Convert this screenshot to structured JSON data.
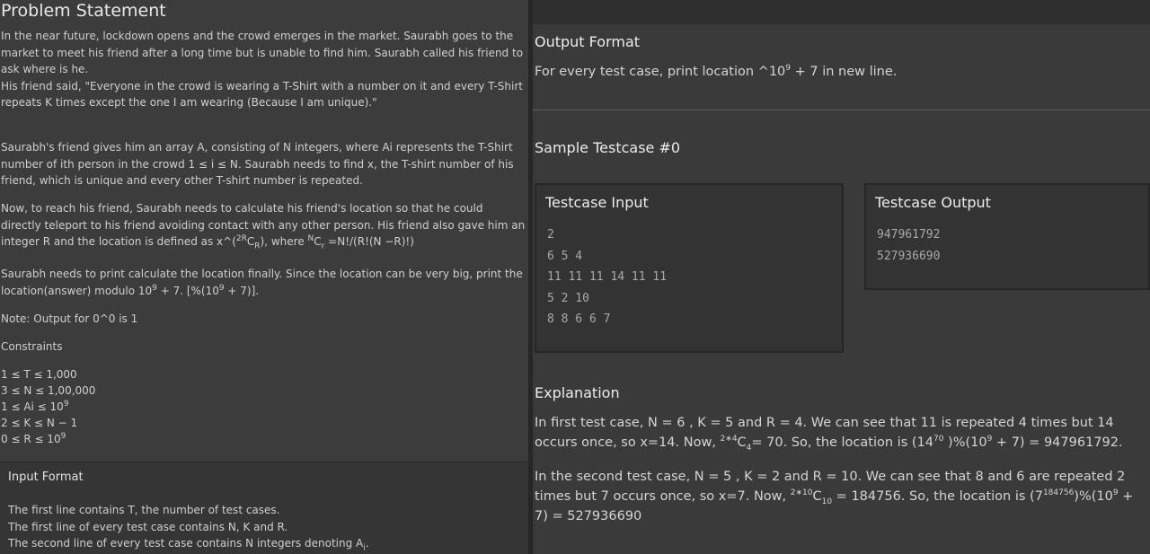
{
  "problem": {
    "title": "Problem Statement",
    "p1a": "In the near future, lockdown opens and the crowd emerges in the market. Saurabh goes to the market to meet his friend after a long time but is unable to find him. Saurabh called his friend to ask where is he.",
    "p1b": "His friend said, \"Everyone in the crowd is wearing a T-Shirt with a number on it and every T-Shirt repeats K times except the one I am wearing (Because I am unique).\"",
    "p2": "Saurabh's friend gives him an array A, consisting of N integers, where Ai represents the T-Shirt number of ith person in the crowd 1 ≤ i ≤ N. Saurabh needs to find x, the T-shirt number of his friend, which is unique and every other T-shirt number is repeated.",
    "p3_main": "Now, to reach his friend, Saurabh needs to calculate his friend's location so that he could directly teleport to his friend avoiding contact with any other person. His friend also gave him an integer R and the location is defined as x^(",
    "p3_sup1": "2R",
    "p3_c": "C",
    "p3_sub1": "R",
    "p3_mid": "), where ",
    "p3_sup2": "N",
    "p3_c2": "C",
    "p3_sub2": "r",
    "p3_end": " =N!/(R!(N −R)!)",
    "p4_a": "Saurabh needs to print calculate the location finally. Since the location can be very big, print the location(answer) modulo 10",
    "p4_sup": "9",
    "p4_b": " + 7. [%(10",
    "p4_sup2": "9",
    "p4_c": " + 7)].",
    "note": "Note: Output for 0^0 is 1",
    "constraints_label": "Constraints",
    "constraints": [
      {
        "text": "1 ≤ T ≤ 1,000",
        "sup": ""
      },
      {
        "text": "3 ≤ N ≤ 1,00,000",
        "sup": ""
      },
      {
        "text": "1 ≤ Ai ≤ 10",
        "sup": "9"
      },
      {
        "text": "2 ≤ K ≤ N − 1",
        "sup": ""
      },
      {
        "text": "0 ≤ R ≤ 10",
        "sup": "9"
      }
    ],
    "input_format": {
      "title": "Input Format",
      "line1": "The first line contains T, the number of test cases.",
      "line2": "The first line of every test case contains N, K and R.",
      "line3_a": "The second line of every test case contains N integers denoting A",
      "line3_sub": "i",
      "line3_b": "."
    }
  },
  "right": {
    "output_format_title": "Output Format",
    "output_format_a": "For every test case, print location ^10",
    "output_format_sup": "9",
    "output_format_b": " + 7 in new line.",
    "sample_title": "Sample Testcase #0",
    "input_box_title": "Testcase Input",
    "input_lines": [
      "2",
      "6 5 4",
      "11 11 11 14 11 11",
      "5 2 10",
      "8 8 6 6 7"
    ],
    "output_box_title": "Testcase Output",
    "output_lines": [
      "947961792",
      "527936690"
    ],
    "explanation_title": "Explanation",
    "exp1_a": "In first test case, N = 6 , K = 5 and R = 4. We can see that 11 is repeated 4 times but 14 occurs once, so x=14. Now, ",
    "exp1_sup": "2∗4",
    "exp1_b": "C",
    "exp1_sub": "4",
    "exp1_c": "= 70. So, the location is (14",
    "exp1_sup2": "70",
    "exp1_d": " )%(10",
    "exp1_sup3": "9",
    "exp1_e": " + 7) = 947961792.",
    "exp2_a": "In the second test case, N = 5 , K = 2 and R = 10. We can see that 8 and 6 are repeated 2 times but 7 occurs once, so x=7. Now, ",
    "exp2_sup": "2∗10",
    "exp2_b": "C",
    "exp2_sub": "10",
    "exp2_c": " = 184756. So, the location is (7",
    "exp2_sup2": "184756",
    "exp2_d": ")%(10",
    "exp2_sup3": "9",
    "exp2_e": " + 7) = 527936690"
  }
}
